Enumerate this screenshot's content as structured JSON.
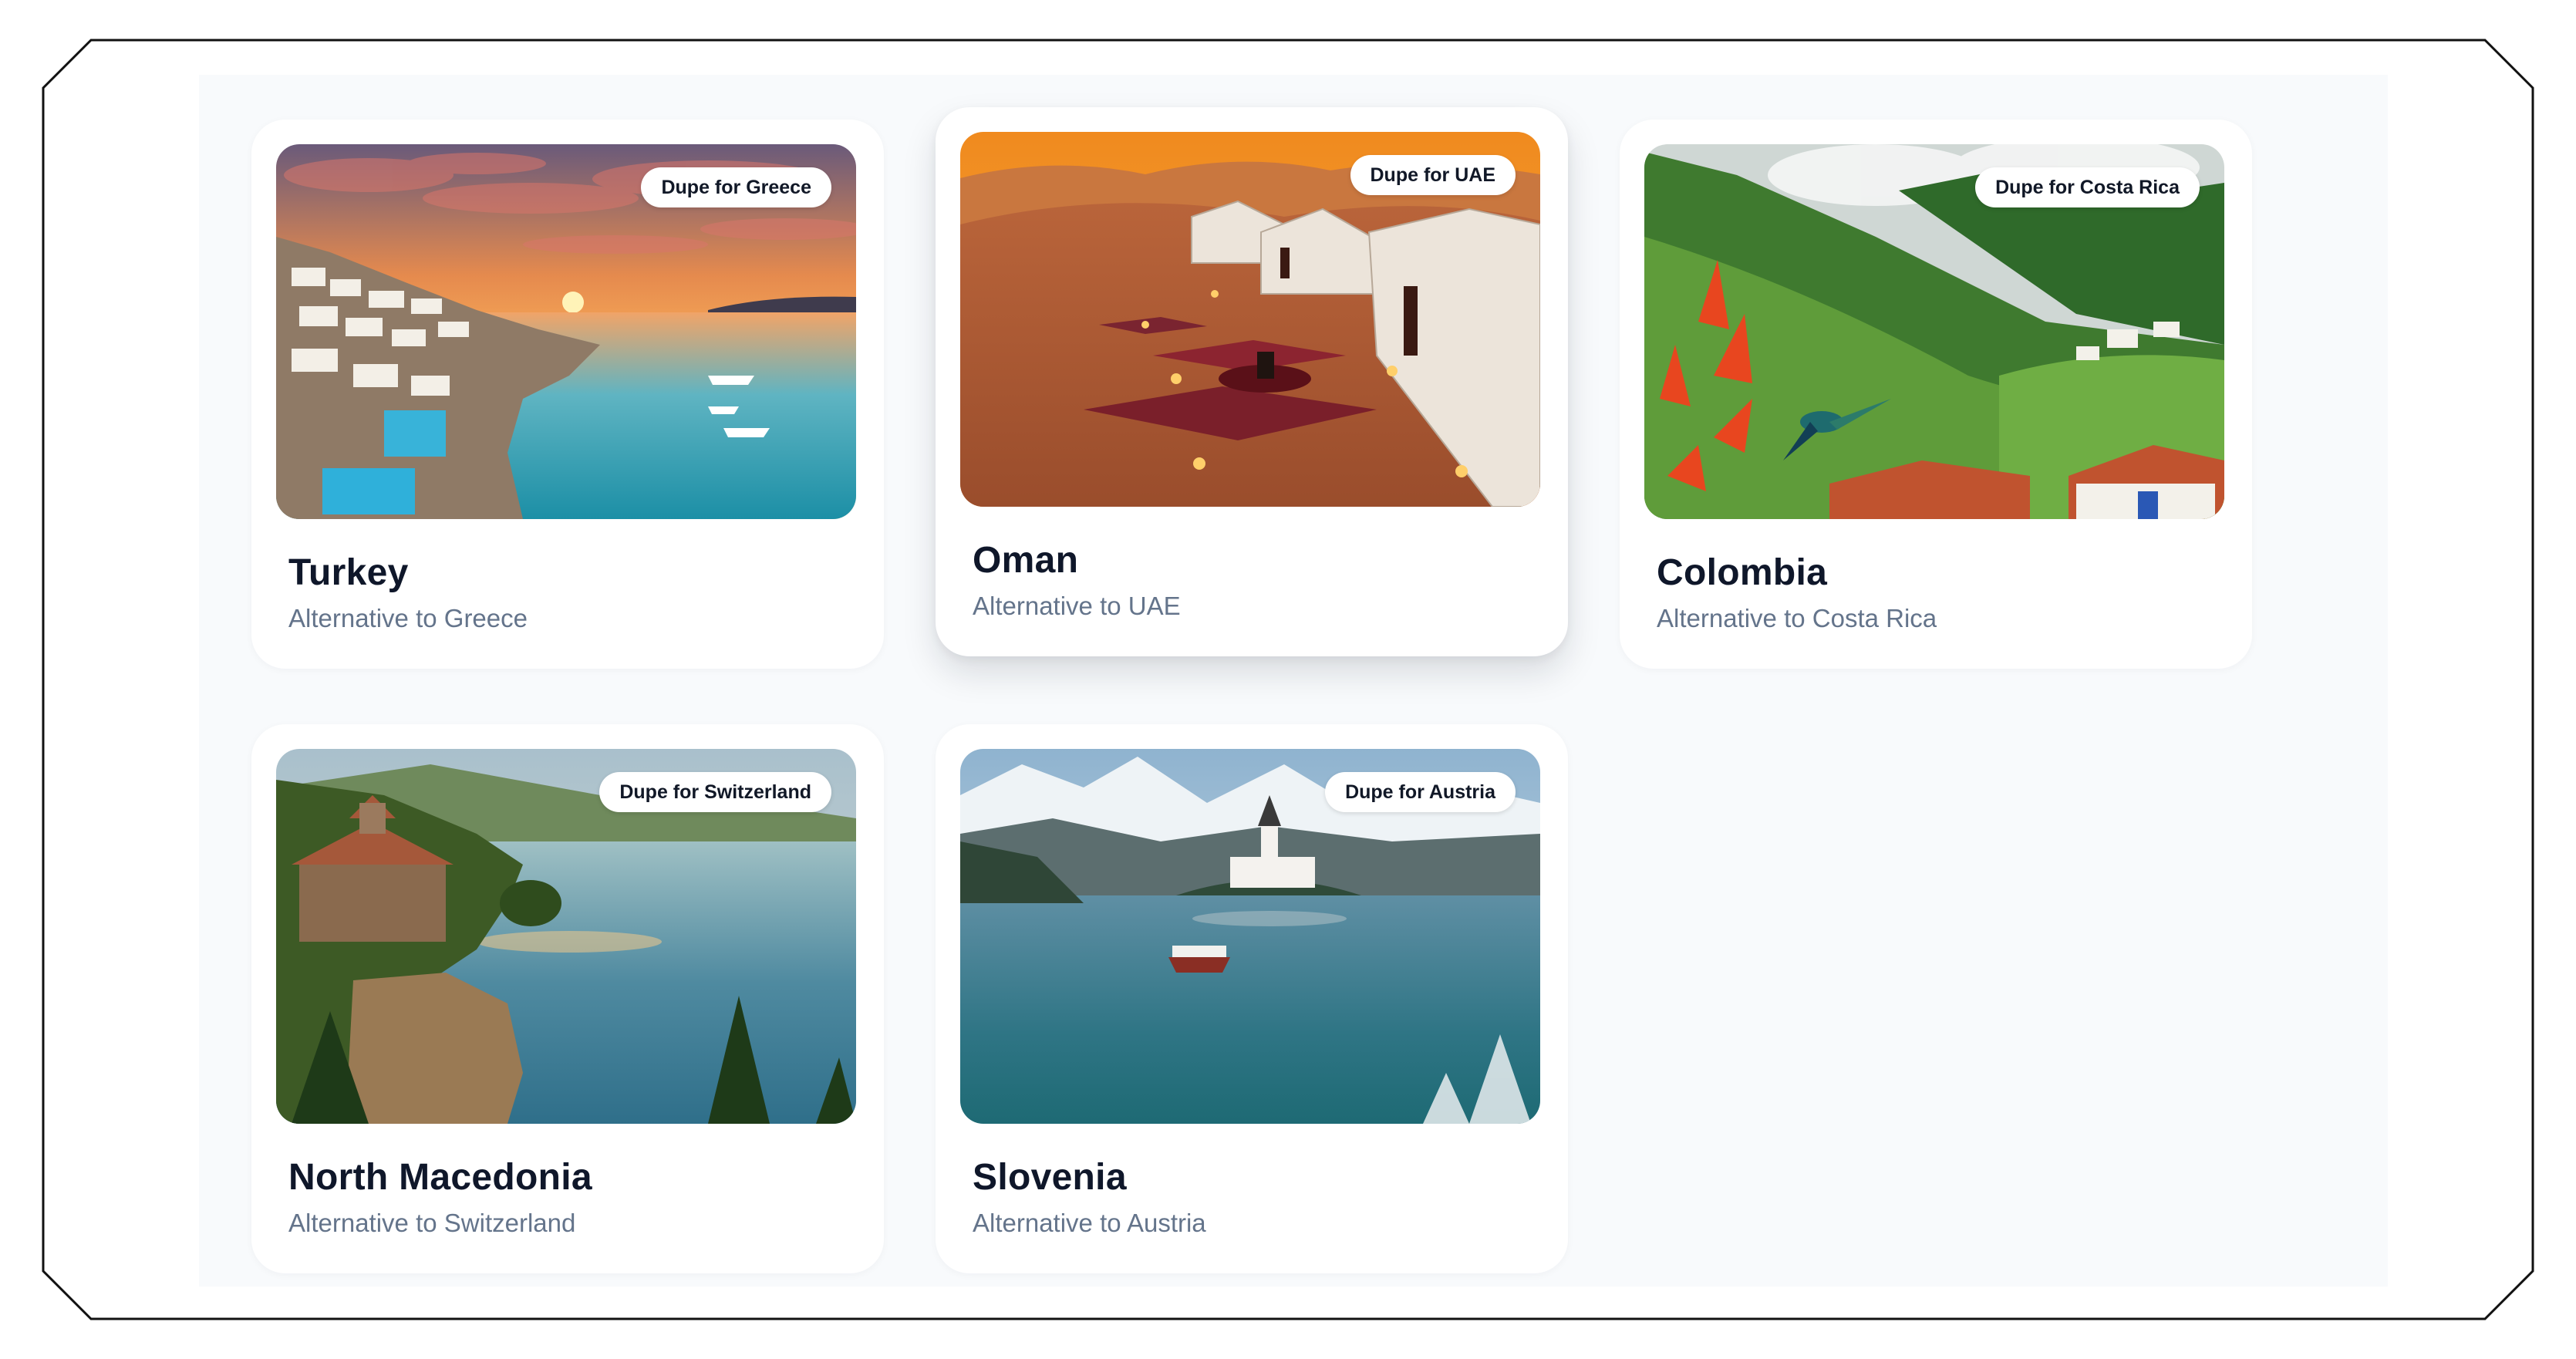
{
  "destinations": [
    {
      "name": "Turkey",
      "subtitle": "Alternative to Greece",
      "badge": "Dupe for Greece",
      "image_icon": "coastal-sunset-photo"
    },
    {
      "name": "Oman",
      "subtitle": "Alternative to UAE",
      "badge": "Dupe for UAE",
      "image_icon": "desert-camp-photo"
    },
    {
      "name": "Colombia",
      "subtitle": "Alternative to Costa Rica",
      "badge": "Dupe for Costa Rica",
      "image_icon": "green-valley-hummingbird-photo"
    },
    {
      "name": "North Macedonia",
      "subtitle": "Alternative to Switzerland",
      "badge": "Dupe for Switzerland",
      "image_icon": "lake-church-photo"
    },
    {
      "name": "Slovenia",
      "subtitle": "Alternative to Austria",
      "badge": "Dupe for Austria",
      "image_icon": "alpine-lake-island-photo"
    }
  ],
  "colors": {
    "panel_background": "#f8fafc",
    "card_background": "#ffffff",
    "title_text": "#0f172a",
    "subtitle_text": "#64748b",
    "badge_background": "#ffffff"
  }
}
